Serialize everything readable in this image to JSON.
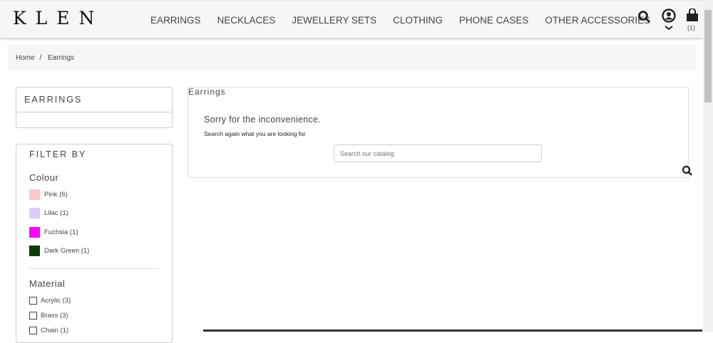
{
  "header": {
    "logo": "KLEN",
    "nav": [
      "EARRINGS",
      "NECKLACES",
      "JEWELLERY SETS",
      "CLOTHING",
      "PHONE CASES",
      "OTHER ACCESSORIES"
    ],
    "cart_count": "(1)"
  },
  "breadcrumb": {
    "home": "Home",
    "sep": "/",
    "current": "Earrings"
  },
  "sidebar": {
    "category_title": "EARRINGS",
    "filter_title": "FILTER BY",
    "colour_title": "Colour",
    "colours": [
      {
        "label": "Pink (6)",
        "color": "#f9c8c8"
      },
      {
        "label": "Lilac (1)",
        "color": "#dcccfa"
      },
      {
        "label": "Fuchsia (1)",
        "color": "#ff00ff"
      },
      {
        "label": "Dark Green (1)",
        "color": "#0b3d0b"
      }
    ],
    "material_title": "Material",
    "materials": [
      "Acrylic (3)",
      "Brass (3)",
      "Chain (1)"
    ]
  },
  "main": {
    "title": "Earrings",
    "sorry": "Sorry for the inconvenience.",
    "hint": "Search again what you are looking for",
    "search_placeholder": "Search our catalog"
  }
}
